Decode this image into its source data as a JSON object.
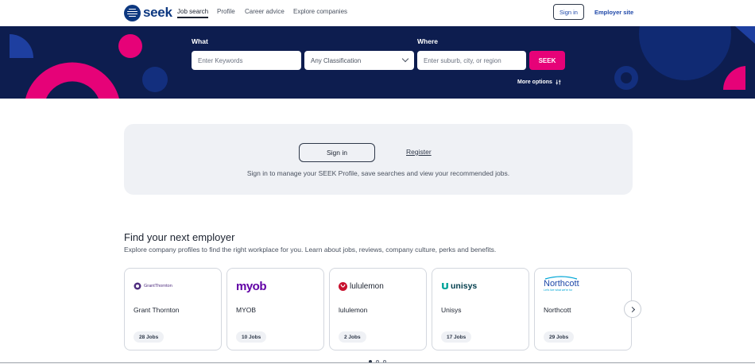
{
  "nav": {
    "brand": "seek",
    "links": [
      "Job search",
      "Profile",
      "Career advice",
      "Explore companies"
    ],
    "sign_in": "Sign in",
    "employer_site": "Employer site"
  },
  "search": {
    "what_label": "What",
    "where_label": "Where",
    "keywords_placeholder": "Enter Keywords",
    "classification_value": "Any Classification",
    "location_placeholder": "Enter suburb, city, or region",
    "button": "SEEK",
    "more_options": "More options"
  },
  "signin_card": {
    "sign_in": "Sign in",
    "register": "Register",
    "message": "Sign in to manage your SEEK Profile, save searches and view your recommended jobs."
  },
  "employers": {
    "title": "Find your next employer",
    "subtitle": "Explore company profiles to find the right workplace for you. Learn about jobs, reviews, company culture, perks and benefits.",
    "cards": [
      {
        "logo_text": "GrantThornton",
        "name": "Grant Thornton",
        "jobs": "28 Jobs"
      },
      {
        "logo_text": "myob",
        "name": "MYOB",
        "jobs": "10 Jobs"
      },
      {
        "logo_text": "lululemon",
        "name": "lululemon",
        "jobs": "2 Jobs"
      },
      {
        "logo_text": "unisys",
        "name": "Unisys",
        "jobs": "17 Jobs"
      },
      {
        "logo_text": "Northcott",
        "logo_tagline": "Let's live what we're for",
        "name": "Northcott",
        "jobs": "29 Jobs"
      }
    ]
  },
  "colors": {
    "hero_bg": "#0d1d4f",
    "brand_pink": "#e60278",
    "brand_blue": "#0d3880",
    "link_blue": "#1e47a8"
  }
}
